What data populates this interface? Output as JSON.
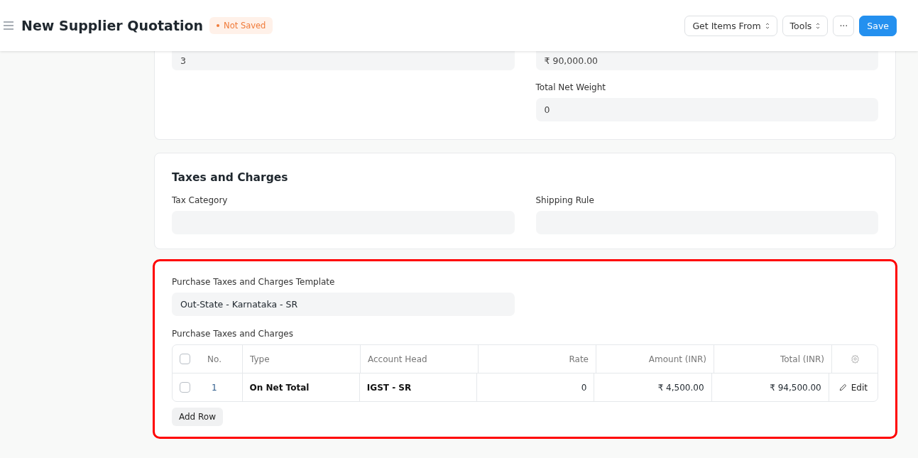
{
  "header": {
    "title": "New Supplier Quotation",
    "status": "Not Saved",
    "buttons": [
      {
        "label": "Get Items From",
        "kind": "dropdown"
      },
      {
        "label": "Tools",
        "kind": "dropdown"
      },
      {
        "label": "···",
        "kind": "more"
      },
      {
        "label": "Save",
        "kind": "primary"
      }
    ]
  },
  "totals_card": {
    "left_value": "3",
    "right_value": "₹ 90,000.00",
    "fields": [
      {
        "label": "Total Net Weight",
        "value": "0"
      }
    ]
  },
  "taxes_card": {
    "heading": "Taxes and Charges",
    "fields": [
      {
        "label": "Tax Category"
      },
      {
        "label": "Shipping Rule"
      }
    ]
  },
  "charges_card": {
    "highlighted": true,
    "template_label": "Purchase Taxes and Charges Template",
    "template_value": "Out-State - Karnataka - SR",
    "table_label": "Purchase Taxes and Charges",
    "table": {
      "columns": [
        {
          "label": "No."
        },
        {
          "label": "Type"
        },
        {
          "label": "Account Head"
        },
        {
          "label": "Rate"
        },
        {
          "label": "Amount (INR)"
        },
        {
          "label": "Total (INR)"
        }
      ],
      "rows": [
        {
          "checked": false,
          "cells": [
            "1",
            "On Net Total",
            "IGST - SR",
            "0",
            "₹ 4,500.00",
            "₹ 94,500.00"
          ],
          "action": "Edit"
        }
      ],
      "header_checked": false
    },
    "add_row": "Add Row"
  }
}
